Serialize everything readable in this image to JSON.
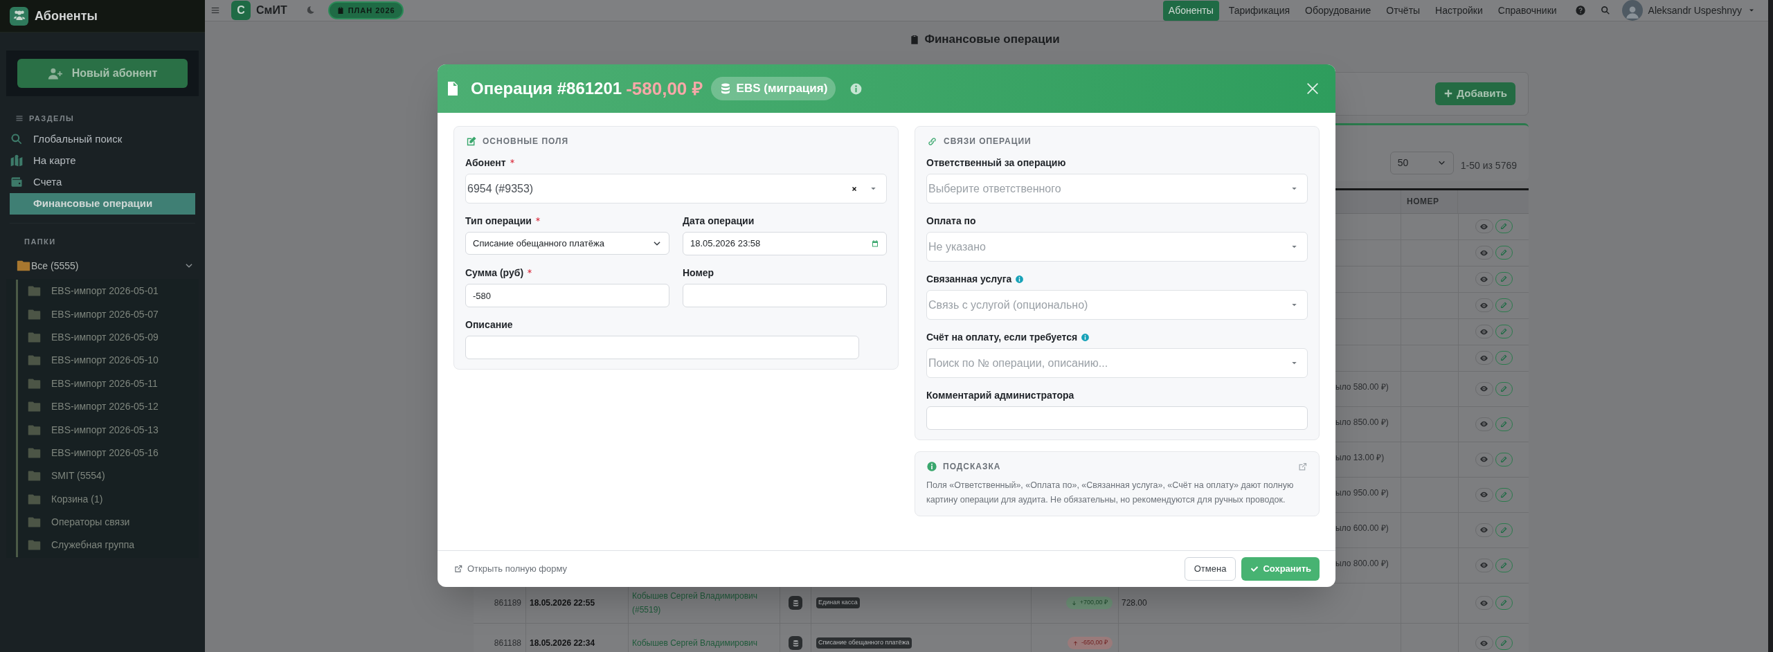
{
  "sidebar": {
    "title": "Абоненты",
    "new_button": "Новый абонент",
    "sections_heading": "РАЗДЕЛЫ",
    "nav": [
      {
        "label": "Глобальный поиск",
        "selected": false
      },
      {
        "label": "На карте",
        "selected": false
      },
      {
        "label": "Счета",
        "selected": false
      },
      {
        "label": "Финансовые операции",
        "selected": true
      }
    ],
    "folders_heading": "ПАПКИ",
    "root_folder": {
      "label": "Все (5555)",
      "expanded": true,
      "children": [
        {
          "label": "EBS-импорт 2026-05-01"
        },
        {
          "label": "EBS-импорт 2026-05-07"
        },
        {
          "label": "EBS-импорт 2026-05-09"
        },
        {
          "label": "EBS-импорт 2026-05-10"
        },
        {
          "label": "EBS-импорт 2026-05-11"
        },
        {
          "label": "EBS-импорт 2026-05-12"
        },
        {
          "label": "EBS-импорт 2026-05-13"
        },
        {
          "label": "EBS-импорт 2026-05-16"
        },
        {
          "label": "SMIT (5554)"
        },
        {
          "label": "Корзина (1)"
        },
        {
          "label": "Операторы связи"
        },
        {
          "label": "Служебная группа"
        }
      ]
    }
  },
  "topbar": {
    "logo_letter": "С",
    "app_name": "СмИТ",
    "plan_badge": "ПЛАН 2026",
    "nav": [
      {
        "label": "Абоненты",
        "selected": true
      },
      {
        "label": "Тарификация",
        "selected": false
      },
      {
        "label": "Оборудование",
        "selected": false
      },
      {
        "label": "Отчёты",
        "selected": false
      },
      {
        "label": "Настройки",
        "selected": false
      },
      {
        "label": "Справочники",
        "selected": false
      }
    ],
    "user": "Aleksandr Uspeshnyy"
  },
  "page": {
    "title": "Финансовые операции",
    "add_button": "Добавить",
    "page_size": "50",
    "range": "1-50 из 5769",
    "table": {
      "columns": [
        "НОМЕР"
      ],
      "rows": [
        {
          "kind": "covered"
        },
        {
          "kind": "covered"
        },
        {
          "kind": "covered"
        },
        {
          "kind": "covered"
        },
        {
          "kind": "covered"
        },
        {
          "kind": "covered"
        },
        {
          "kind": "covered",
          "note": "ыло 580.00 ₽)"
        },
        {
          "kind": "covered",
          "note": "ыло 850.00 ₽)"
        },
        {
          "kind": "covered",
          "note": "ыло 13.00 ₽)"
        },
        {
          "kind": "covered",
          "note": "ыло 950.00 ₽)"
        },
        {
          "kind": "covered",
          "note": "ыло 600.00 ₽)"
        },
        {
          "kind": "covered",
          "note": "ыло 800.00 ₽)"
        },
        {
          "kind": "full",
          "id": "861189",
          "date": "18.05.2026 22:55",
          "name": "Кобышев Сергей Владимирович",
          "name_id": "(#5519)",
          "tag": "Единая касса",
          "amount": "+700,00 ₽",
          "incoming": true,
          "balance": "728.00"
        },
        {
          "kind": "full",
          "id": "861188",
          "date": "18.05.2026 22:34",
          "name": "Кобышев Сергей Владимирович",
          "tag": "Списание обещанного платёжа",
          "amount": "-650,00 ₽",
          "incoming": false
        }
      ]
    }
  },
  "modal": {
    "title": "Операция #861201",
    "amount": "-580,00 ₽",
    "source_badge": "EBS (миграция)",
    "main_section": {
      "heading": "ОСНОВНЫЕ ПОЛЯ",
      "fields": [
        {
          "kind": "combo",
          "label": "Абонент",
          "required": true,
          "value": "6954 (#9353)",
          "clearable": true
        },
        {
          "kind": "select",
          "label": "Тип операции",
          "required": true,
          "value": "Списание обещанного платёжа"
        },
        {
          "kind": "date",
          "label": "Дата операции",
          "required": false,
          "value": "18.05.2026 23:58"
        },
        {
          "kind": "text",
          "label": "Сумма (руб)",
          "required": true,
          "value": "-580"
        },
        {
          "kind": "text",
          "label": "Номер",
          "required": false
        },
        {
          "kind": "wide_text",
          "label": "Описание",
          "required": false
        }
      ]
    },
    "links_section": {
      "heading": "СВЯЗИ ОПЕРАЦИИ",
      "fields": [
        {
          "kind": "combo",
          "label": "Ответственный за операцию",
          "info": false,
          "placeholder": "Выберите ответственного"
        },
        {
          "kind": "combo",
          "label": "Оплата по",
          "info": false,
          "placeholder": "Не указано"
        },
        {
          "kind": "combo",
          "label": "Связанная услуга",
          "info": true,
          "placeholder": "Связь с услугой (опционально)"
        },
        {
          "kind": "combo",
          "label": "Счёт на оплату, если требуется",
          "info": true,
          "placeholder": "Поиск по № операции, описанию..."
        },
        {
          "kind": "text",
          "label": "Комментарий администратора",
          "info": false
        }
      ]
    },
    "hint": {
      "heading": "ПОДСКАЗКА",
      "text": "Поля «Ответственный», «Оплата по», «Связанная услуга», «Счёт на оплату» дают полную картину операции для аудита. Не обязательны, но рекомендуются для ручных проводок."
    },
    "open_full_form": "Открыть полную форму",
    "buttons": [
      {
        "kind": "secondary",
        "label": "Отмена"
      },
      {
        "kind": "primary",
        "label": "Сохранить"
      }
    ]
  }
}
